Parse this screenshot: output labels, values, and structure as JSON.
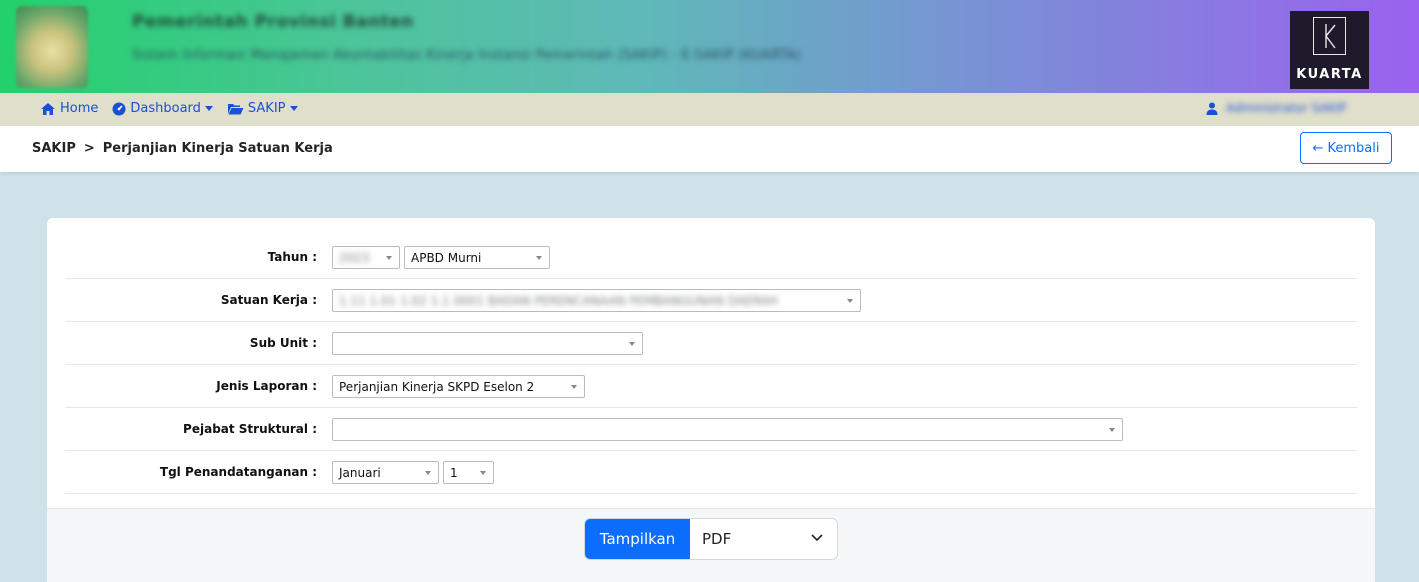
{
  "banner": {
    "title": "Pemerintah Provinsi Banten",
    "subtitle": "Sistem Informasi Manajemen Akuntabilitas Kinerja Instansi Pemerintah (SAKIP) - E-SAKIP (KUARTA)",
    "brand": "KUARTA"
  },
  "nav": {
    "home": "Home",
    "dashboard": "Dashboard",
    "sakip": "SAKIP",
    "user": "Administrator SAKIP"
  },
  "breadcrumb": {
    "root": "SAKIP",
    "separator": ">",
    "current": "Perjanjian Kinerja Satuan Kerja"
  },
  "back_button": "← Kembali",
  "form": {
    "tahun": {
      "label": "Tahun :",
      "year": "2023",
      "type": "APBD Murni"
    },
    "satuan_kerja": {
      "label": "Satuan Kerja :",
      "value": "1.11 1.01 1.02 1.1 0001 BADAN PERENCANAAN PEMBANGUNAN DAERAH"
    },
    "sub_unit": {
      "label": "Sub Unit :",
      "value": ""
    },
    "jenis_laporan": {
      "label": "Jenis Laporan :",
      "value": "Perjanjian Kinerja SKPD Eselon 2"
    },
    "pejabat_struktural": {
      "label": "Pejabat Struktural :",
      "value": ""
    },
    "tgl_penandatanganan": {
      "label": "Tgl Penandatanganan :",
      "month": "Januari",
      "day": "1"
    }
  },
  "footer": {
    "show_button": "Tampilkan",
    "format": "PDF"
  },
  "colors": {
    "primary": "#0d6efd",
    "nav_bg": "#e0dfcb",
    "page_bg": "#cfe2ea"
  }
}
